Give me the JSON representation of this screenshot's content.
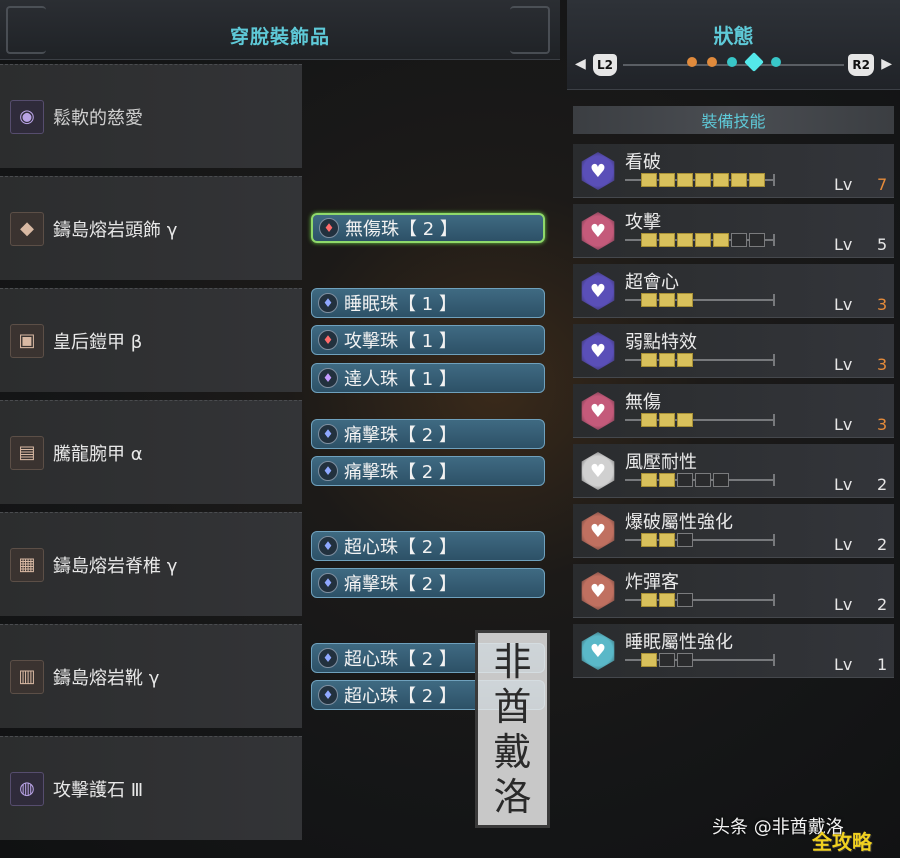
{
  "left_panel": {
    "title": "穿脫裝飾品",
    "equipment": [
      {
        "name": "鬆軟的慈愛",
        "icon": "weapon-icon",
        "glyph": "◉",
        "decorations": []
      },
      {
        "name": "鑄島熔岩頭飾 γ",
        "icon": "helm-icon",
        "glyph": "◆",
        "decorations": [
          {
            "name": "無傷珠【 2 】",
            "jewel": "red",
            "selected": true
          }
        ]
      },
      {
        "name": "皇后鎧甲 β",
        "icon": "chest-icon",
        "glyph": "▣",
        "decorations": [
          {
            "name": "睡眠珠【 1 】",
            "jewel": "blue"
          },
          {
            "name": "攻擊珠【 1 】",
            "jewel": "red"
          },
          {
            "name": "達人珠【 1 】",
            "jewel": "purple"
          }
        ]
      },
      {
        "name": "騰龍腕甲 α",
        "icon": "arm-icon",
        "glyph": "▤",
        "decorations": [
          {
            "name": "痛擊珠【 2 】",
            "jewel": "blue"
          },
          {
            "name": "痛擊珠【 2 】",
            "jewel": "blue"
          }
        ]
      },
      {
        "name": "鑄島熔岩脊椎 γ",
        "icon": "waist-icon",
        "glyph": "▦",
        "decorations": [
          {
            "name": "超心珠【 2 】",
            "jewel": "blue"
          },
          {
            "name": "痛擊珠【 2 】",
            "jewel": "blue"
          }
        ]
      },
      {
        "name": "鑄島熔岩靴 γ",
        "icon": "leg-icon",
        "glyph": "▥",
        "decorations": [
          {
            "name": "超心珠【 2 】",
            "jewel": "blue"
          },
          {
            "name": "超心珠【 2 】",
            "jewel": "blue"
          }
        ]
      },
      {
        "name": "攻擊護石 Ⅲ",
        "icon": "charm-icon",
        "glyph": "◍",
        "decorations": []
      }
    ]
  },
  "right_panel": {
    "title": "狀態",
    "nav": {
      "left_button": "L2",
      "right_button": "R2",
      "page_count": 5,
      "active_page": 4
    },
    "section_title": "裝備技能",
    "lv_label": "Lv",
    "skills": [
      {
        "name": "看破",
        "level": 7,
        "max": 7,
        "color": "#5a4fb8",
        "icon": "critical-eye-skill-icon"
      },
      {
        "name": "攻擊",
        "level": 5,
        "max": 7,
        "color": "#c45a7a",
        "icon": "attack-boost-skill-icon"
      },
      {
        "name": "超會心",
        "level": 3,
        "max": 3,
        "color": "#5a4fb8",
        "icon": "critical-boost-skill-icon"
      },
      {
        "name": "弱點特效",
        "level": 3,
        "max": 3,
        "color": "#5a4fb8",
        "icon": "weakness-exploit-skill-icon"
      },
      {
        "name": "無傷",
        "level": 3,
        "max": 3,
        "color": "#c45a7a",
        "icon": "peak-performance-skill-icon"
      },
      {
        "name": "風壓耐性",
        "level": 2,
        "max": 5,
        "color": "#d0d0d0",
        "icon": "windproof-skill-icon"
      },
      {
        "name": "爆破屬性強化",
        "level": 2,
        "max": 3,
        "color": "#c07060",
        "icon": "blast-attack-skill-icon"
      },
      {
        "name": "炸彈客",
        "level": 2,
        "max": 3,
        "color": "#c07060",
        "icon": "bombardier-skill-icon"
      },
      {
        "name": "睡眠屬性強化",
        "level": 1,
        "max": 3,
        "color": "#5ab8c8",
        "icon": "sleep-attack-skill-icon"
      }
    ]
  },
  "watermarks": {
    "seal_text": [
      "非",
      "酋",
      "戴",
      "洛"
    ],
    "author": "头条 @非酋戴洛",
    "site": "全攻略"
  },
  "colors": {
    "accent": "#5ec9d7",
    "max_level": "#e58b3a",
    "pip_on": "#d9c15c",
    "selected_border": "#8fd96a"
  }
}
